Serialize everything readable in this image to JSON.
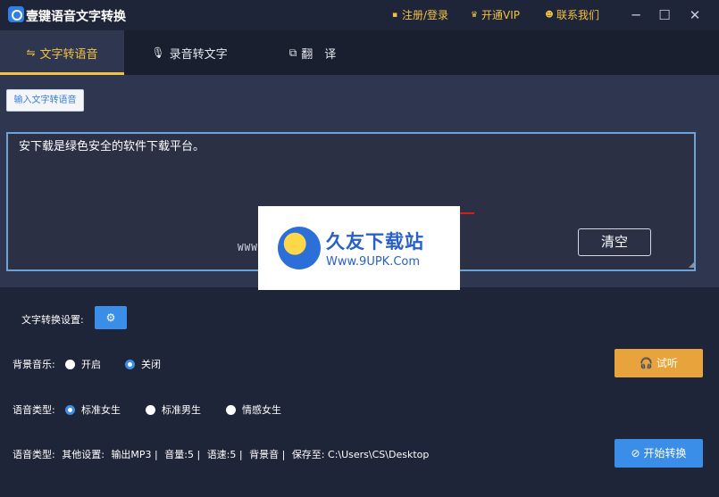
{
  "titlebar": {
    "title": "壹键语音文字转换",
    "register_login": "注册/登录",
    "open_vip": "开通VIP",
    "contact_us": "联系我们",
    "minimize": "─",
    "maximize": "☐",
    "close": "✕"
  },
  "tabs": [
    {
      "label": "文字转语音",
      "active": true
    },
    {
      "label": "录音转文字",
      "active": false
    },
    {
      "label": "翻　译",
      "active": false
    }
  ],
  "input_button": "输入文字转语音",
  "text_content": "安下载是绿色安全的软件下载平台。",
  "clear_button": "清空",
  "watermark": {
    "title": "久友下载站",
    "url": "Www.9UPK.Com",
    "side_text": "WWW.9UPK.COM"
  },
  "settings": {
    "conversion_settings_label": "文字转换设置:",
    "background_music_label": "背景音乐:",
    "background_music_options": [
      {
        "label": "开启",
        "selected": false
      },
      {
        "label": "关闭",
        "selected": true
      }
    ],
    "voice_type_label": "语音类型:",
    "voice_type_options": [
      {
        "label": "标准女生",
        "selected": true
      },
      {
        "label": "标准男生",
        "selected": false
      },
      {
        "label": "情感女生",
        "selected": false
      }
    ],
    "listen_button": "试听",
    "start_button": "开始转换"
  },
  "status": {
    "label": "语音类型:",
    "other": "其他设置:",
    "output": "输出MP3 |",
    "volume": "音量:5 |",
    "speed": "语速:5 |",
    "bg_sound": "背景音 |",
    "save_to": "保存至: C:\\Users\\CS\\Desktop"
  },
  "colors": {
    "accent_gold": "#f2c244",
    "accent_blue": "#3b8ee8",
    "listen_orange": "#e8a33c",
    "background": "#1f2538",
    "panel": "#2f3650"
  }
}
